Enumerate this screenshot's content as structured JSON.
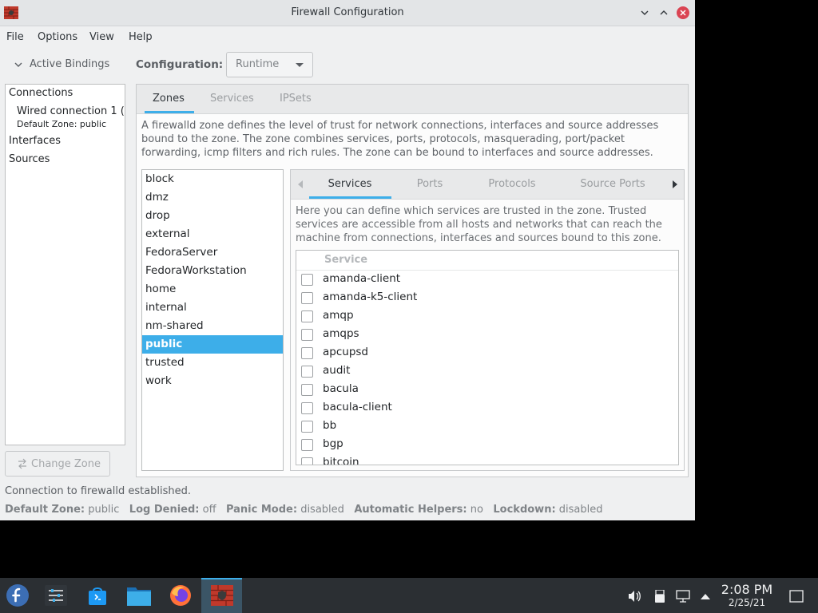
{
  "window": {
    "title": "Firewall Configuration",
    "app_icon": "firewall-brick-icon"
  },
  "menu": [
    "File",
    "Options",
    "View",
    "Help"
  ],
  "bindings": {
    "header": "Active Bindings",
    "items": [
      {
        "label": "Connections",
        "kind": "category"
      },
      {
        "label": "Wired connection 1 (",
        "kind": "connection"
      },
      {
        "label": "Default Zone: public",
        "kind": "connection-zone"
      },
      {
        "label": "Interfaces",
        "kind": "category"
      },
      {
        "label": "Sources",
        "kind": "category"
      }
    ],
    "change_zone_label": "Change Zone"
  },
  "configuration": {
    "label": "Configuration:",
    "value": "Runtime"
  },
  "main_tabs": [
    {
      "label": "Zones",
      "active": true
    },
    {
      "label": "Services",
      "active": false
    },
    {
      "label": "IPSets",
      "active": false
    }
  ],
  "zone_description": "A firewalld zone defines the level of trust for network connections, interfaces and source addresses bound to the zone. The zone combines services, ports, protocols, masquerading, port/packet forwarding, icmp filters and rich rules. The zone can be bound to interfaces and source addresses.",
  "zones": [
    "block",
    "dmz",
    "drop",
    "external",
    "FedoraServer",
    "FedoraWorkstation",
    "home",
    "internal",
    "nm-shared",
    "public",
    "trusted",
    "work"
  ],
  "selected_zone": "public",
  "zone_tabs": [
    {
      "label": "Services",
      "active": true
    },
    {
      "label": "Ports",
      "active": false
    },
    {
      "label": "Protocols",
      "active": false
    },
    {
      "label": "Source Ports",
      "active": false
    }
  ],
  "services_description": "Here you can define which services are trusted in the zone. Trusted services are accessible from all hosts and networks that can reach the machine from connections, interfaces and sources bound to this zone.",
  "services_header": "Service",
  "services": [
    {
      "name": "amanda-client",
      "checked": false
    },
    {
      "name": "amanda-k5-client",
      "checked": false
    },
    {
      "name": "amqp",
      "checked": false
    },
    {
      "name": "amqps",
      "checked": false
    },
    {
      "name": "apcupsd",
      "checked": false
    },
    {
      "name": "audit",
      "checked": false
    },
    {
      "name": "bacula",
      "checked": false
    },
    {
      "name": "bacula-client",
      "checked": false
    },
    {
      "name": "bb",
      "checked": false
    },
    {
      "name": "bgp",
      "checked": false
    },
    {
      "name": "bitcoin",
      "checked": false
    }
  ],
  "status": {
    "message": "Connection to firewalld established.",
    "default_zone_label": "Default Zone:",
    "default_zone": "public",
    "log_denied_label": "Log Denied:",
    "log_denied": "off",
    "panic_mode_label": "Panic Mode:",
    "panic_mode": "disabled",
    "automatic_helpers_label": "Automatic Helpers:",
    "automatic_helpers": "no",
    "lockdown_label": "Lockdown:",
    "lockdown": "disabled"
  },
  "taskbar": {
    "apps": [
      "fedora-launcher-icon",
      "settings-sliders-icon",
      "software-store-icon",
      "file-manager-icon",
      "firefox-icon",
      "firewall-brick-icon"
    ],
    "tray": [
      "volume-icon",
      "usb-device-icon",
      "network-icon",
      "expand-tray-icon"
    ],
    "time": "2:08 PM",
    "date": "2/25/21"
  },
  "colors": {
    "accent": "#3daee9",
    "close": "#da4453",
    "taskbar": "#2b2f33"
  }
}
